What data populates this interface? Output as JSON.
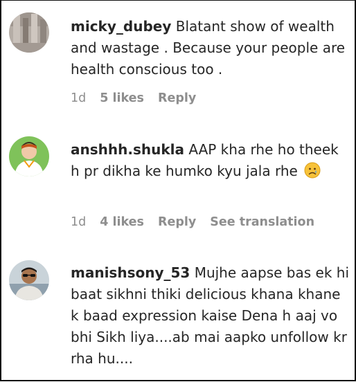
{
  "comments": [
    {
      "username": "micky_dubey",
      "text": "Blatant show of wealth and wastage . Because your people are health conscious too .",
      "time": "1d",
      "likes": "5 likes",
      "reply": "Reply",
      "avatar": "stone-wall-avatar"
    },
    {
      "username": "anshhh.shukla",
      "text": "AAP kha rhe ho theek h pr dikha ke humko kyu jala rhe",
      "emoji": "sad-tear-face",
      "time": "1d",
      "likes": "4 likes",
      "reply": "Reply",
      "translate": "See translation",
      "avatar": "cartoon-man-avatar"
    },
    {
      "username": "manishsony_53",
      "text": "Mujhe aapse bas ek hi baat sikhni thiki delicious khana khane k baad expression kaise Dena h aaj vo bhi Sikh liya....ab mai aapko unfollow kr rha hu....",
      "avatar": "man-sunglasses-avatar"
    }
  ],
  "colors": {
    "text": "#262626",
    "muted": "#8e8e8e"
  }
}
